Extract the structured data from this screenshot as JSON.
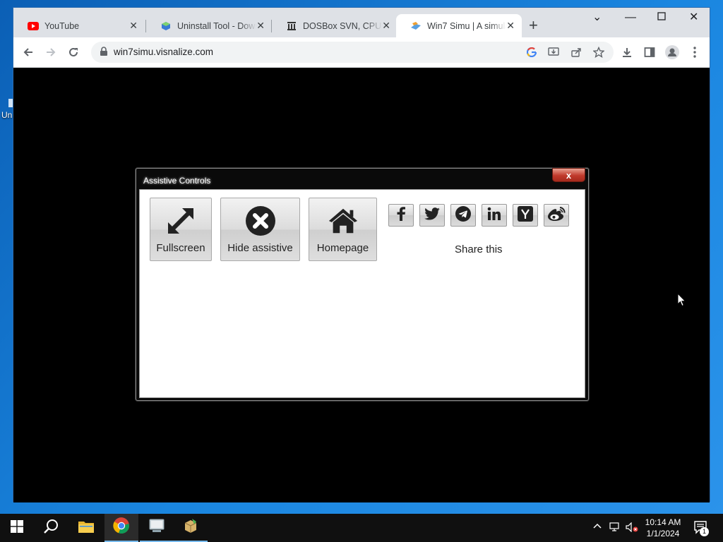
{
  "desktop": {
    "icon_label": "Un"
  },
  "browser": {
    "tabs": [
      {
        "title": "YouTube",
        "icon": "youtube-icon"
      },
      {
        "title": "Uninstall Tool - Down",
        "icon": "uninstall-tool-icon"
      },
      {
        "title": "DOSBox SVN, CPU sp",
        "icon": "bank-icon"
      },
      {
        "title": "Win7 Simu | A simula",
        "icon": "win7simu-icon"
      }
    ],
    "url": "win7simu.visnalize.com"
  },
  "dialog": {
    "title": "Assistive Controls",
    "close_label": "x",
    "buttons": [
      {
        "label": "Fullscreen",
        "icon": "expand-arrows-icon"
      },
      {
        "label": "Hide assistive",
        "icon": "times-circle-icon"
      },
      {
        "label": "Homepage",
        "icon": "home-icon"
      }
    ],
    "share": {
      "label": "Share this",
      "services": [
        "facebook",
        "twitter",
        "telegram",
        "linkedin",
        "hacker-news",
        "weibo"
      ]
    }
  },
  "taskbar": {
    "time": "10:14 AM",
    "date": "1/1/2024",
    "notification_count": "1"
  }
}
